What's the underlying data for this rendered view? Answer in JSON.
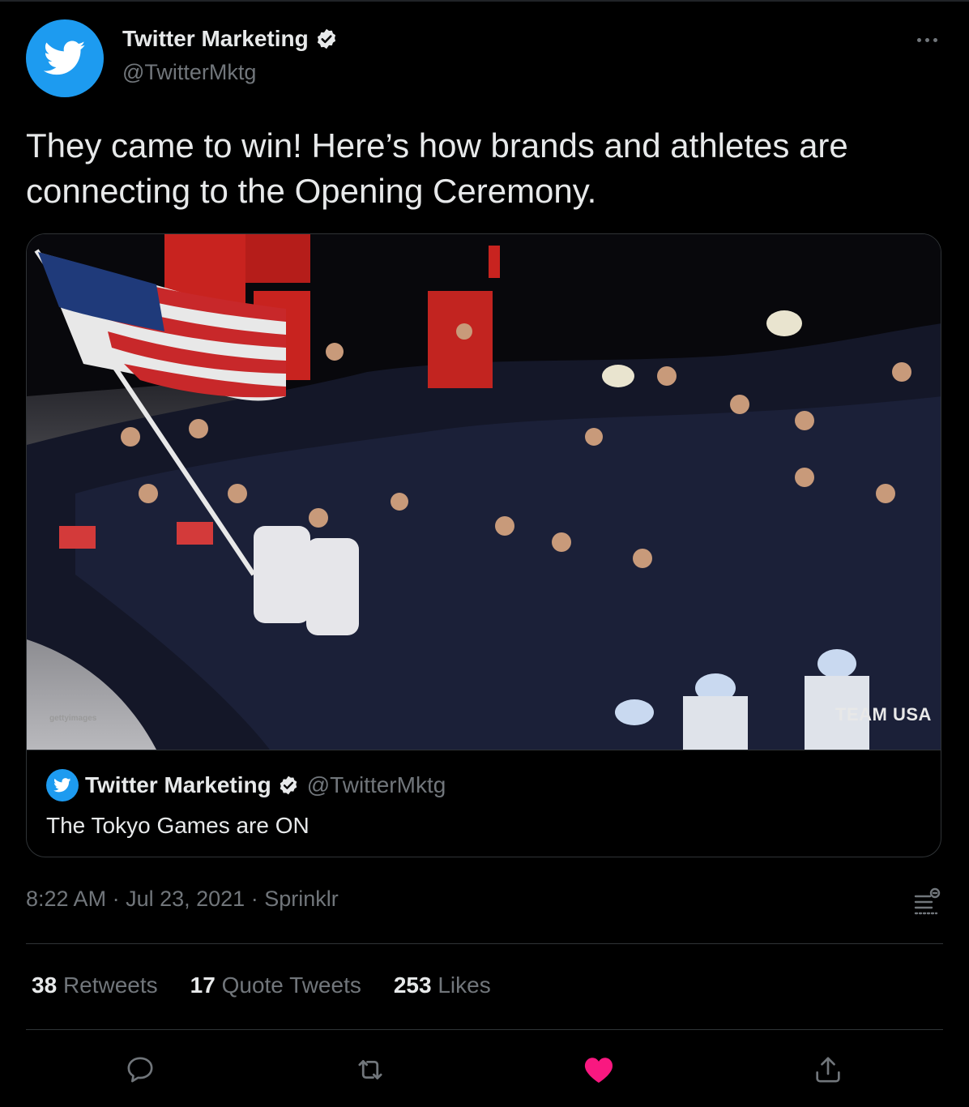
{
  "author": {
    "name": "Twitter Marketing",
    "handle": "@TwitterMktg",
    "verified": true,
    "avatar_icon": "twitter-bird-icon",
    "avatar_color": "#1d9bf0"
  },
  "tweet": {
    "text": "They came to win! Here’s how brands and athletes are connecting to the Opening Ceremony."
  },
  "media": {
    "watermark": "gettyimages",
    "overlay_text": "TEAM USA"
  },
  "quoted_tweet": {
    "name": "Twitter Marketing",
    "handle": "@TwitterMktg",
    "text": "The Tokyo Games are ON"
  },
  "meta": {
    "time": "8:22 AM",
    "separator": " · ",
    "date": "Jul 23, 2021",
    "source": "Sprinklr"
  },
  "stats": {
    "retweets_count": "38",
    "retweets_label": "Retweets",
    "quotes_count": "17",
    "quotes_label": "Quote Tweets",
    "likes_count": "253",
    "likes_label": "Likes"
  },
  "actions": {
    "reply_icon": "reply-icon",
    "retweet_icon": "retweet-icon",
    "like_icon": "heart-filled-icon",
    "share_icon": "share-icon",
    "like_color": "#f91880",
    "icon_color": "#71767b"
  },
  "theme": {
    "background": "#000000",
    "text": "#e7e9ea",
    "muted": "#71767b",
    "border": "#2f3336",
    "accent": "#1d9bf0"
  }
}
